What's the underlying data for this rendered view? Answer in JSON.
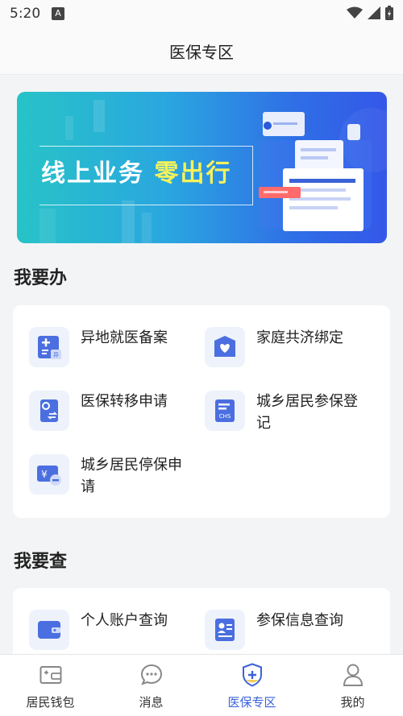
{
  "status_bar": {
    "time": "5:20"
  },
  "header": {
    "title": "医保专区"
  },
  "banner": {
    "slogan_part1": "线上业务",
    "slogan_part2": "零出行"
  },
  "todo_section": {
    "title": "我要办",
    "items": [
      {
        "label": "异地就医备案",
        "icon": "remote-medical-icon"
      },
      {
        "label": "家庭共济绑定",
        "icon": "heart-shield-icon"
      },
      {
        "label": "医保转移申请",
        "icon": "transfer-icon"
      },
      {
        "label": "城乡居民参保登记",
        "icon": "chs-register-icon"
      },
      {
        "label": "城乡居民停保申请",
        "icon": "stop-insurance-icon"
      }
    ]
  },
  "query_section": {
    "title": "我要查",
    "items": [
      {
        "label": "个人账户查询",
        "icon": "wallet-icon"
      },
      {
        "label": "参保信息查询",
        "icon": "id-card-icon"
      }
    ]
  },
  "tabbar": {
    "tabs": [
      {
        "label": "居民钱包",
        "icon": "wallet-tab-icon",
        "active": false
      },
      {
        "label": "消息",
        "icon": "message-icon",
        "active": false
      },
      {
        "label": "医保专区",
        "icon": "medical-shield-icon",
        "active": true
      },
      {
        "label": "我的",
        "icon": "person-icon",
        "active": false
      }
    ]
  },
  "colors": {
    "accent": "#3a62d8",
    "icon_blue": "#4b6fe0",
    "banner_highlight": "#f6f25a"
  }
}
